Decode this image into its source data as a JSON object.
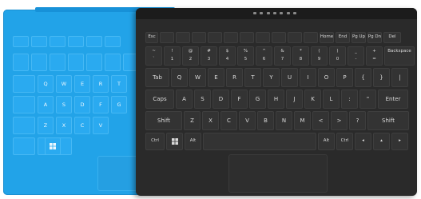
{
  "blue_keyboard": {
    "rows": [
      [
        "",
        "",
        "",
        "",
        "",
        ""
      ],
      [
        "",
        "",
        "",
        "",
        "",
        "",
        ""
      ],
      [
        "",
        "Q",
        "W",
        "E",
        "R",
        "T"
      ],
      [
        "",
        "A",
        "S",
        "D",
        "F",
        "G"
      ],
      [
        "",
        "Z",
        "X",
        "C",
        "V"
      ],
      [
        "",
        "",
        ""
      ]
    ]
  },
  "black_keyboard": {
    "fn_row": [
      "Esc",
      "",
      "",
      "",
      "",
      "",
      "",
      "",
      "",
      "",
      "",
      "Home",
      "End",
      "Pg Up",
      "Pg Dn",
      "Del"
    ],
    "number_row": [
      "~",
      "!",
      "@",
      "#",
      "$",
      "%",
      "^",
      "&",
      "*",
      "(",
      ")",
      "_",
      "+",
      "Backspace"
    ],
    "number_row_lower": [
      "`",
      "1",
      "2",
      "3",
      "4",
      "5",
      "6",
      "7",
      "8",
      "9",
      "0",
      "-",
      "="
    ],
    "qwerty_row": [
      "Tab",
      "Q",
      "W",
      "E",
      "R",
      "T",
      "Y",
      "U",
      "I",
      "O",
      "P",
      "{",
      "}",
      "|"
    ],
    "home_row": [
      "Caps",
      "A",
      "S",
      "D",
      "F",
      "G",
      "H",
      "J",
      "K",
      "L",
      ":",
      "\"",
      "Enter"
    ],
    "shift_row": [
      "Shift",
      "Z",
      "X",
      "C",
      "V",
      "B",
      "N",
      "M",
      "<",
      ">",
      "?",
      "Shift"
    ],
    "bottom_row": [
      "Ctrl",
      "Fn",
      "Alt",
      "Alt",
      "Ctrl"
    ]
  },
  "colors": {
    "blue_cover": "#22a3e8",
    "black_cover": "#2a2a2a",
    "key_text": "#d9d9d9"
  }
}
